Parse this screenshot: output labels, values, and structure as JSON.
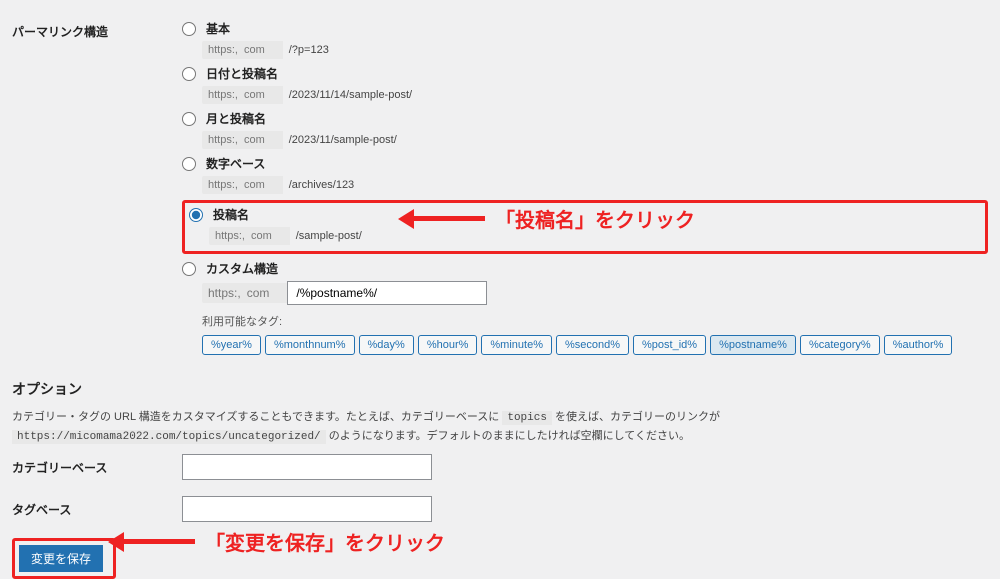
{
  "permalink": {
    "section_label": "パーマリンク構造",
    "url_prefix": "https:,",
    "url_domain": "com",
    "options": [
      {
        "label": "基本",
        "suffix": "/?p=123",
        "selected": false
      },
      {
        "label": "日付と投稿名",
        "suffix": "/2023/11/14/sample-post/",
        "selected": false
      },
      {
        "label": "月と投稿名",
        "suffix": "/2023/11/sample-post/",
        "selected": false
      },
      {
        "label": "数字ベース",
        "suffix": "/archives/123",
        "selected": false
      },
      {
        "label": "投稿名",
        "suffix": "/sample-post/",
        "selected": true
      },
      {
        "label": "カスタム構造",
        "suffix": "",
        "selected": false
      }
    ],
    "custom_value": "/%postname%/",
    "tags_label": "利用可能なタグ:",
    "tags": [
      "%year%",
      "%monthnum%",
      "%day%",
      "%hour%",
      "%minute%",
      "%second%",
      "%post_id%",
      "%postname%",
      "%category%",
      "%author%"
    ],
    "tag_active": "%postname%"
  },
  "options": {
    "heading": "オプション",
    "description_a": "カテゴリー・タグの URL 構造をカスタマイズすることもできます。たとえば、カテゴリーベースに ",
    "code1": "topics",
    "description_b": " を使えば、カテゴリーのリンクが ",
    "code2": "https://micomama2022.com/topics/uncategorized/",
    "description_c": " のようになります。デフォルトのままにしたければ空欄にしてください。",
    "category_base_label": "カテゴリーベース",
    "category_base_value": "",
    "tag_base_label": "タグベース",
    "tag_base_value": ""
  },
  "save_label": "変更を保存",
  "annotations": {
    "anno1": "「投稿名」をクリック",
    "anno2": "「変更を保存」をクリック"
  }
}
